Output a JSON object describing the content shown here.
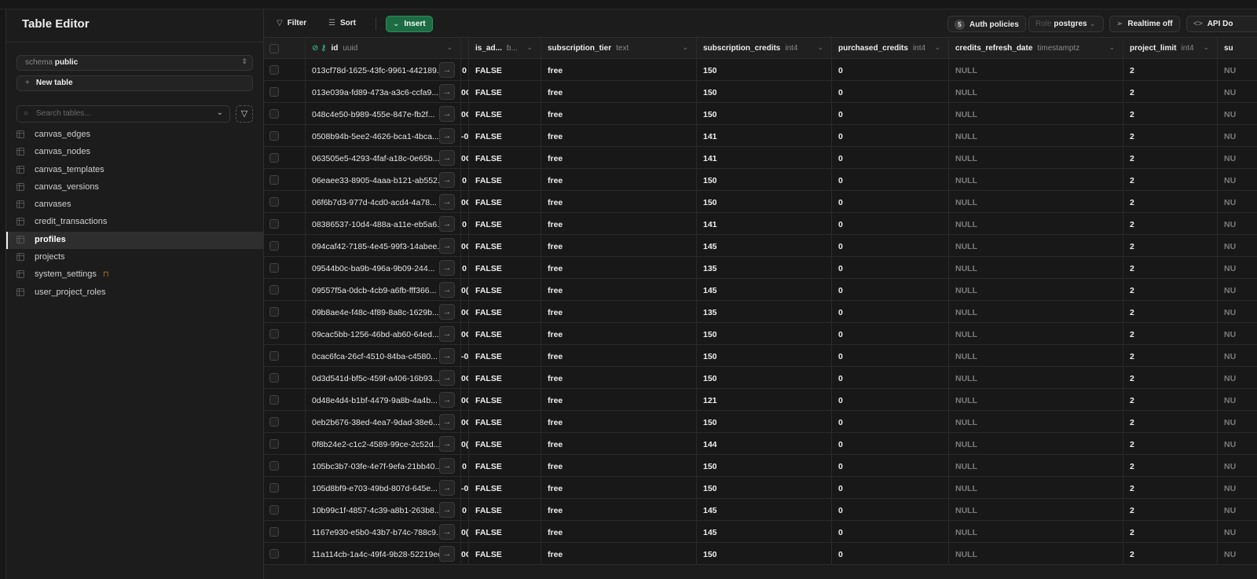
{
  "sidebar": {
    "title": "Table Editor",
    "schema_label": "schema",
    "schema_value": "public",
    "new_table": "New table",
    "search_placeholder": "Search tables...",
    "tables": [
      {
        "name": "canvas_edges"
      },
      {
        "name": "canvas_nodes"
      },
      {
        "name": "canvas_templates"
      },
      {
        "name": "canvas_versions"
      },
      {
        "name": "canvases"
      },
      {
        "name": "credit_transactions"
      },
      {
        "name": "profiles",
        "active": true
      },
      {
        "name": "projects"
      },
      {
        "name": "system_settings",
        "locked": true
      },
      {
        "name": "user_project_roles"
      }
    ]
  },
  "toolbar": {
    "filter": "Filter",
    "sort": "Sort",
    "insert": "Insert",
    "auth_count": "5",
    "auth_policies": "Auth policies",
    "role_label": "Role",
    "role_value": "postgres",
    "realtime": "Realtime off",
    "api_docs": "API Do"
  },
  "accent": "#3ecf8e",
  "columns": [
    {
      "name": "id",
      "type": "uuid"
    },
    {
      "name": "",
      "type": ""
    },
    {
      "name": "is_ad...",
      "type": "b..."
    },
    {
      "name": "subscription_tier",
      "type": "text"
    },
    {
      "name": "subscription_credits",
      "type": "int4"
    },
    {
      "name": "purchased_credits",
      "type": "int4"
    },
    {
      "name": "credits_refresh_date",
      "type": "timestamptz"
    },
    {
      "name": "project_limit",
      "type": "int4"
    },
    {
      "name": "su",
      "type": ""
    }
  ],
  "rows": [
    [
      "013cf78d-1625-43fc-9961-442189...",
      "0",
      "FALSE",
      "free",
      "150",
      "0",
      "NULL",
      "2",
      "NU"
    ],
    [
      "013e039a-fd89-473a-a3c6-ccfa9...",
      "0C",
      "FALSE",
      "free",
      "150",
      "0",
      "NULL",
      "2",
      "NU"
    ],
    [
      "048c4e50-b989-455e-847e-fb2f...",
      "0C",
      "FALSE",
      "free",
      "150",
      "0",
      "NULL",
      "2",
      "NU"
    ],
    [
      "0508b94b-5ee2-4626-bca1-4bca...",
      "-0",
      "FALSE",
      "free",
      "141",
      "0",
      "NULL",
      "2",
      "NU"
    ],
    [
      "063505e5-4293-4faf-a18c-0e65b...",
      "0C",
      "FALSE",
      "free",
      "141",
      "0",
      "NULL",
      "2",
      "NU"
    ],
    [
      "06eaee33-8905-4aaa-b121-ab552...",
      "0",
      "FALSE",
      "free",
      "150",
      "0",
      "NULL",
      "2",
      "NU"
    ],
    [
      "06f6b7d3-977d-4cd0-acd4-4a78...",
      "0C",
      "FALSE",
      "free",
      "150",
      "0",
      "NULL",
      "2",
      "NU"
    ],
    [
      "08386537-10d4-488a-a11e-eb5a6...",
      "0",
      "FALSE",
      "free",
      "141",
      "0",
      "NULL",
      "2",
      "NU"
    ],
    [
      "094caf42-7185-4e45-99f3-14abee...",
      "0C",
      "FALSE",
      "free",
      "145",
      "0",
      "NULL",
      "2",
      "NU"
    ],
    [
      "09544b0c-ba9b-496a-9b09-244...",
      "0",
      "FALSE",
      "free",
      "135",
      "0",
      "NULL",
      "2",
      "NU"
    ],
    [
      "09557f5a-0dcb-4cb9-a6fb-fff366...",
      "0(",
      "FALSE",
      "free",
      "145",
      "0",
      "NULL",
      "2",
      "NU"
    ],
    [
      "09b8ae4e-f48c-4f89-8a8c-1629b...",
      "0C",
      "FALSE",
      "free",
      "135",
      "0",
      "NULL",
      "2",
      "NU"
    ],
    [
      "09cac5bb-1256-46bd-ab60-64ed...",
      "0C",
      "FALSE",
      "free",
      "150",
      "0",
      "NULL",
      "2",
      "NU"
    ],
    [
      "0cac6fca-26cf-4510-84ba-c4580...",
      "-0",
      "FALSE",
      "free",
      "150",
      "0",
      "NULL",
      "2",
      "NU"
    ],
    [
      "0d3d541d-bf5c-459f-a406-16b93...",
      "0C",
      "FALSE",
      "free",
      "150",
      "0",
      "NULL",
      "2",
      "NU"
    ],
    [
      "0d48e4d4-b1bf-4479-9a8b-4a4b...",
      "0C",
      "FALSE",
      "free",
      "121",
      "0",
      "NULL",
      "2",
      "NU"
    ],
    [
      "0eb2b676-38ed-4ea7-9dad-38e6...",
      "0C",
      "FALSE",
      "free",
      "150",
      "0",
      "NULL",
      "2",
      "NU"
    ],
    [
      "0f8b24e2-c1c2-4589-99ce-2c52d...",
      "0(",
      "FALSE",
      "free",
      "144",
      "0",
      "NULL",
      "2",
      "NU"
    ],
    [
      "105bc3b7-03fe-4e7f-9efa-21bb40...",
      "0",
      "FALSE",
      "free",
      "150",
      "0",
      "NULL",
      "2",
      "NU"
    ],
    [
      "105d8bf9-e703-49bd-807d-645e...",
      "-0",
      "FALSE",
      "free",
      "150",
      "0",
      "NULL",
      "2",
      "NU"
    ],
    [
      "10b99c1f-4857-4c39-a8b1-263b8...",
      "0",
      "FALSE",
      "free",
      "145",
      "0",
      "NULL",
      "2",
      "NU"
    ],
    [
      "1167e930-e5b0-43b7-b74c-788c9...",
      "0(",
      "FALSE",
      "free",
      "145",
      "0",
      "NULL",
      "2",
      "NU"
    ],
    [
      "11a114cb-1a4c-49f4-9b28-52219ec...",
      "0C",
      "FALSE",
      "free",
      "150",
      "0",
      "NULL",
      "2",
      "NU"
    ]
  ]
}
